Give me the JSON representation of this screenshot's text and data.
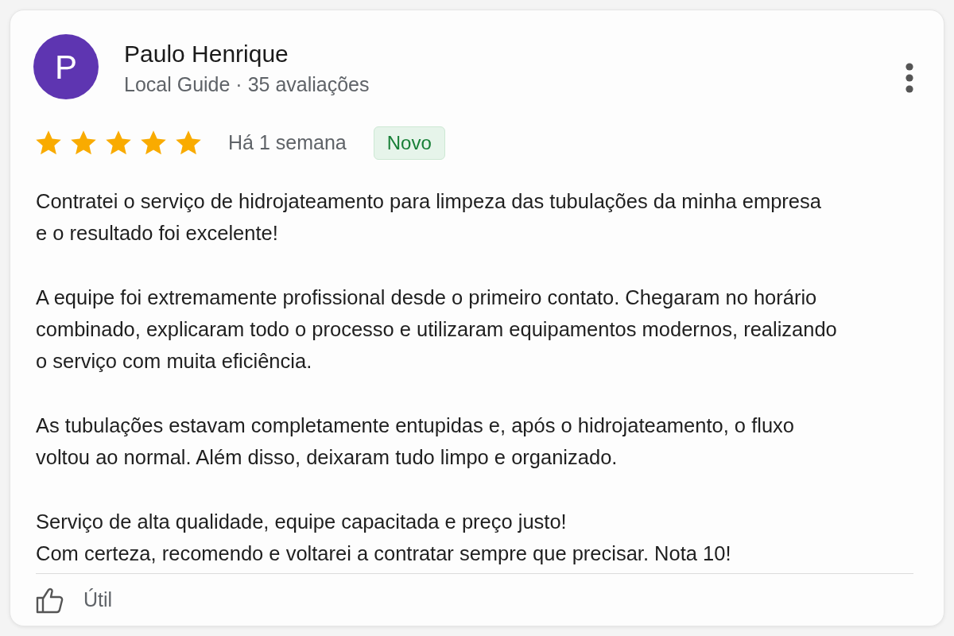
{
  "review": {
    "avatar_letter": "P",
    "author": "Paulo Henrique",
    "subtitle": "Local Guide · 35 avaliações",
    "stars": 5,
    "time": "Há 1 semana",
    "badge": "Novo",
    "paragraphs": [
      "Contratei o serviço de hidrojateamento para limpeza das tubulações da minha empresa\ne o resultado foi excelente!",
      "A equipe foi extremamente profissional desde o primeiro contato. Chegaram no horário\ncombinado, explicaram todo o processo e utilizaram equipamentos modernos, realizando\no serviço com muita eficiência.",
      "As tubulações estavam completamente entupidas e, após o hidrojateamento, o fluxo\nvoltou ao normal. Além disso, deixaram tudo limpo e organizado.",
      "Serviço de alta qualidade, equipe capacitada e preço justo!\nCom certeza, recomendo e voltarei a contratar sempre que precisar. Nota 10!"
    ],
    "helpful_button": "Útil"
  }
}
